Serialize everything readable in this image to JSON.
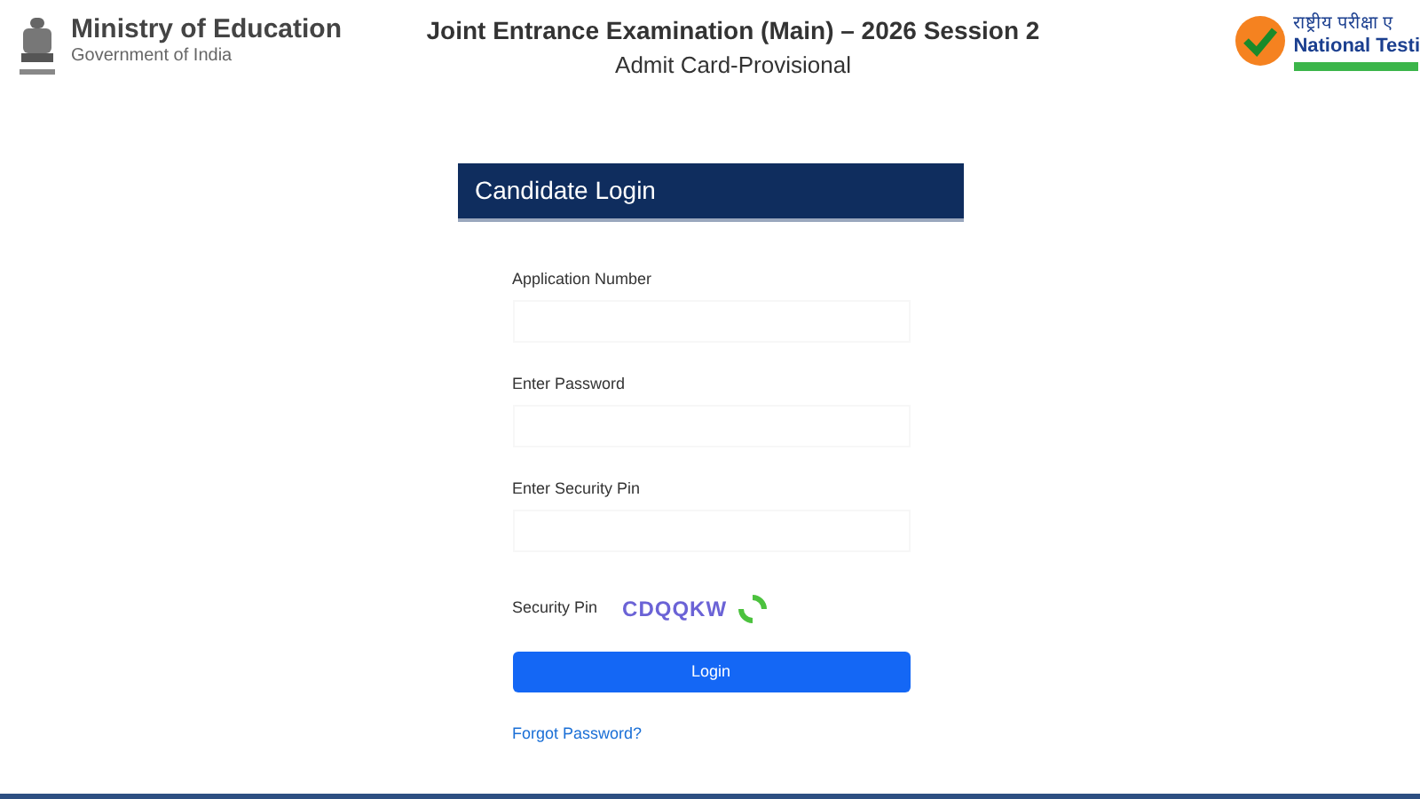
{
  "header": {
    "ministry": "Ministry of Education",
    "government": "Government of India",
    "title": "Joint Entrance Examination (Main) – 2026 Session 2",
    "subtitle": "Admit Card-Provisional",
    "agency_hindi": "राष्ट्रीय परीक्षा ए",
    "agency": "National Testi"
  },
  "login": {
    "title": "Candidate Login",
    "fields": [
      {
        "label": "Application Number"
      },
      {
        "label": "Enter Password"
      },
      {
        "label": "Enter Security Pin"
      }
    ],
    "captcha_label": "Security Pin",
    "captcha": "CDQQKW",
    "button": "Login",
    "forgot": "Forgot Password?"
  }
}
